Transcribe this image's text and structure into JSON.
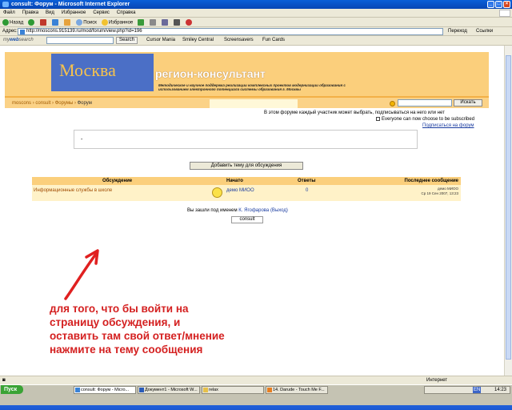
{
  "window": {
    "title": "consult: Форум - Microsoft Internet Explorer"
  },
  "menubar": [
    "Файл",
    "Правка",
    "Вид",
    "Избранное",
    "Сервис",
    "Справка"
  ],
  "toolbar": {
    "back": "Назад",
    "search": "Поиск",
    "favorites": "Избранное"
  },
  "address": {
    "label": "Адрес:",
    "url": "http://moscons.915139.ru/mod/forum/view.php?id=196",
    "go": "Переход",
    "links": "Ссылки"
  },
  "mws": {
    "brand_prefix": "my",
    "brand_main": "web",
    "brand_suffix": "search",
    "search_button": "Search",
    "items": [
      "Cursor Mania",
      "Smiley Central",
      "Screensavers",
      "Fun Cards"
    ]
  },
  "header": {
    "moscow": "Москва",
    "title": "регион-консультант",
    "subtitle": "Методическое и научное поддержка реализации комплексных проектов модернизации образования с использованием электронного потенциала системы образования г. Москвы"
  },
  "nav": {
    "crumb1": "moscons",
    "crumb2": "consult",
    "crumb3": "Форумы",
    "crumb4": "Форум",
    "search_button": "Искать"
  },
  "info": {
    "line1": "В этом форуме каждый участник может выбрать, подписываться на него или нет",
    "line2": "Everyone can now choose to be subscribed",
    "subscribe_link": "Подписаться на форум"
  },
  "intro_text": "-",
  "add_topic_button": "Добавить тему для обсуждения",
  "table": {
    "headers": [
      "Обсуждение",
      "Начато",
      "Ответы",
      "Последнее сообщение"
    ],
    "rows": [
      {
        "topic": "Информационные службы в школе",
        "author": "демо МИОО",
        "replies": "0",
        "last_user": "демо МИОО",
        "last_date": "Ср 19 Сен 2007, 13:23"
      }
    ]
  },
  "login": {
    "prefix": "Вы зашли под именем",
    "user": "К. Ягофарова",
    "logout": "(Выход)",
    "course_button": "consult"
  },
  "annotation": "для того, что бы войти на страницу обсуждения, и оставить там свой ответ/мнение нажмите на тему сообщения",
  "colors": {
    "annotation": "#d42020",
    "header_orange": "#fbcf7c",
    "row_yellow": "#fff2c8",
    "link_blue": "#1a3ca0"
  },
  "status": {
    "zone": "Интернет"
  },
  "taskbar": {
    "start": "Пуск",
    "buttons": [
      "consult: Форум - Micro...",
      "Документ1 - Microsoft W...",
      "relax",
      "14. Darude - Touch Me F..."
    ],
    "lang": "EN",
    "clock": "14:23"
  }
}
